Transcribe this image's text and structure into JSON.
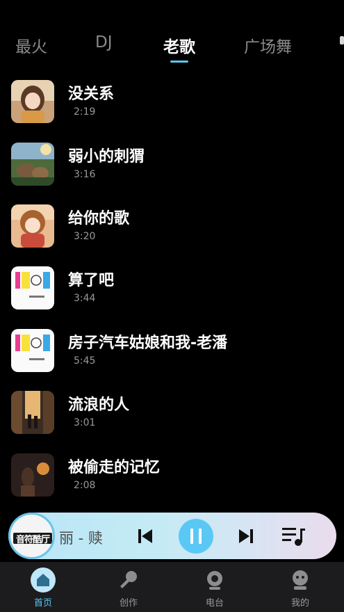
{
  "tabs": [
    {
      "label": "最火"
    },
    {
      "label": "DJ"
    },
    {
      "label": "老歌"
    },
    {
      "label": "广场舞"
    }
  ],
  "active_tab": "老歌",
  "songs": [
    {
      "title": "没关系",
      "duration": "2:19"
    },
    {
      "title": "弱小的刺猬",
      "duration": "3:16"
    },
    {
      "title": "给你的歌",
      "duration": "3:20"
    },
    {
      "title": "算了吧",
      "duration": "3:44"
    },
    {
      "title": "房子汽车姑娘和我-老潘",
      "duration": "5:45"
    },
    {
      "title": "流浪的人",
      "duration": "3:01"
    },
    {
      "title": "被偷走的记忆",
      "duration": "2:08"
    }
  ],
  "player": {
    "logo_text": "音符酷厅",
    "track_text": "丽 - 赎",
    "state": "playing"
  },
  "nav": [
    {
      "label": "首页",
      "icon": "home-icon",
      "active": true
    },
    {
      "label": "创作",
      "icon": "microphone-icon",
      "active": false
    },
    {
      "label": "电台",
      "icon": "radio-icon",
      "active": false
    },
    {
      "label": "我的",
      "icon": "profile-icon",
      "active": false
    }
  ],
  "colors": {
    "accent": "#5ac8f5",
    "background": "#000000",
    "nav_background": "#1c1c1e",
    "inactive_text": "#8a8a8a"
  }
}
